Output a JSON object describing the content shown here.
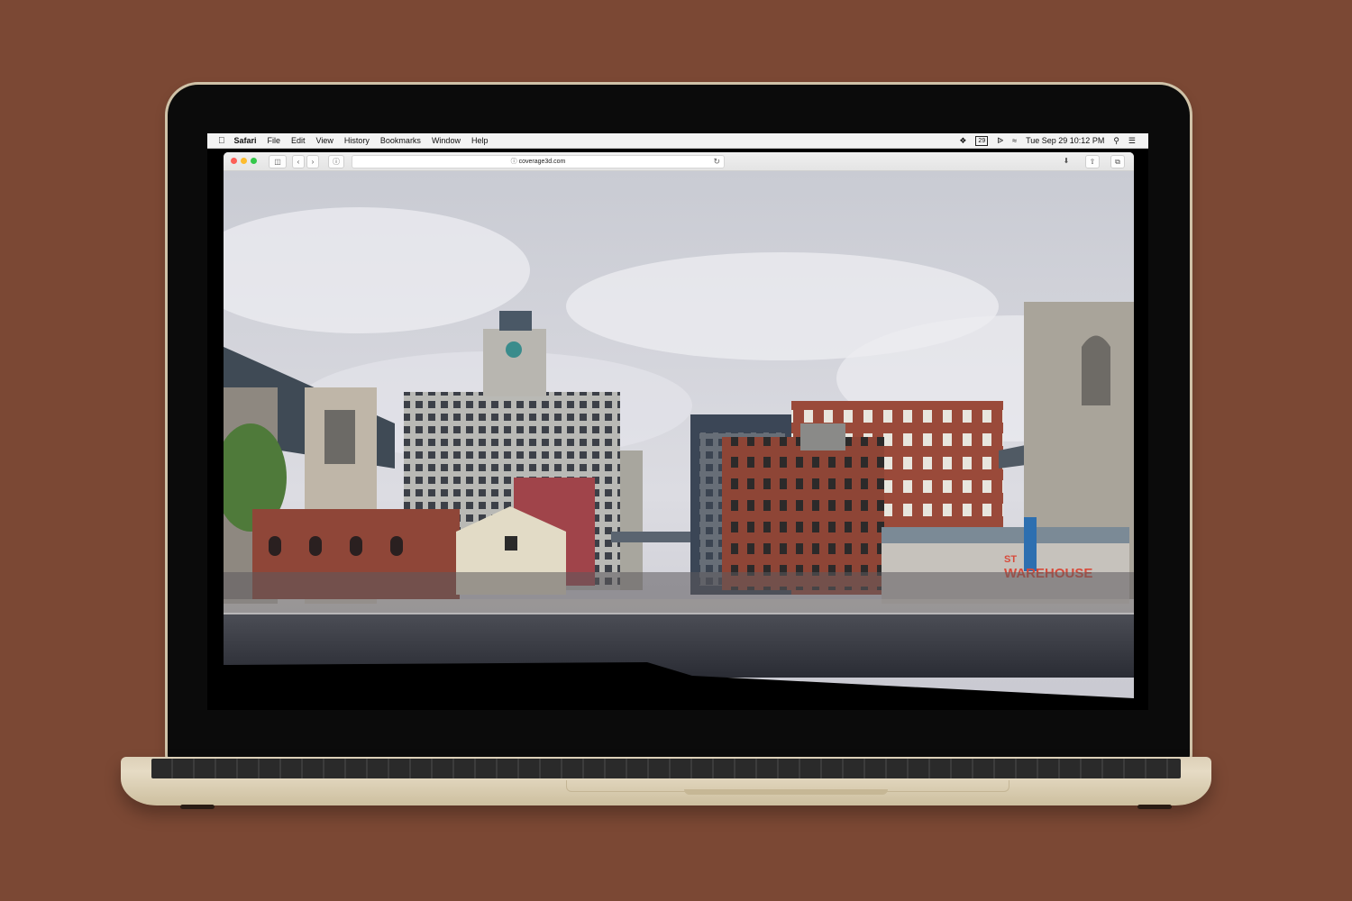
{
  "menubar": {
    "apple_icon": "apple-logo-icon",
    "app_name": "Safari",
    "items": [
      "File",
      "Edit",
      "View",
      "History",
      "Bookmarks",
      "Window",
      "Help"
    ],
    "calendar_badge": "29",
    "datetime": "Tue Sep 29  10:12 PM"
  },
  "browser": {
    "url": "coverage3d.com",
    "traffic_lights": [
      "#fc5f57",
      "#fdbc2e",
      "#34c84a"
    ]
  },
  "scene": {
    "sign_top": "ST",
    "sign_main": "WAREHOUSE"
  },
  "colors": {
    "background": "#7b4834",
    "bezel": "#0b0b0b",
    "laptop_gold": "#dcd0b8"
  }
}
